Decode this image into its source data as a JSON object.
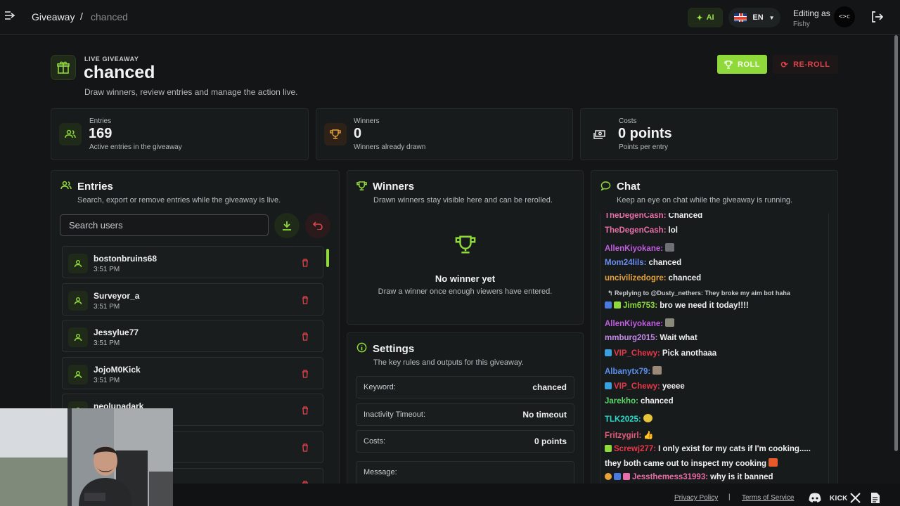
{
  "topbar": {
    "breadcrumb": [
      "Giveaway",
      "/",
      "chanced"
    ],
    "ai_label": "AI",
    "lang": "EN",
    "editing_as": "Editing as",
    "user": "Fishy",
    "avatar_text": "<>c"
  },
  "header": {
    "kicker": "LIVE GIVEAWAY",
    "title": "chanced",
    "subtitle": "Draw winners, review entries and manage the action live.",
    "roll_label": "ROLL",
    "reroll_label": "RE-ROLL"
  },
  "stats": [
    {
      "label": "Entries",
      "value": "169",
      "sub": "Active entries in the giveaway"
    },
    {
      "label": "Winners",
      "value": "0",
      "sub": "Winners already drawn"
    },
    {
      "label": "Costs",
      "value": "0 points",
      "sub": "Points per entry"
    }
  ],
  "entries": {
    "title": "Entries",
    "subtitle": "Search, export or remove entries while the giveaway is live.",
    "search_placeholder": "Search users",
    "items": [
      {
        "name": "bostonbruins68",
        "time": "3:51 PM"
      },
      {
        "name": "Surveyor_a",
        "time": "3:51 PM"
      },
      {
        "name": "Jessylue77",
        "time": "3:51 PM"
      },
      {
        "name": "JojoM0Kick",
        "time": "3:51 PM"
      },
      {
        "name": "neolunadark",
        "time": ""
      },
      {
        "name": "",
        "time": ""
      },
      {
        "name": "",
        "time": ""
      }
    ]
  },
  "winners": {
    "title": "Winners",
    "subtitle": "Drawn winners stay visible here and can be rerolled.",
    "empty_title": "No winner yet",
    "empty_sub": "Draw a winner once enough viewers have entered."
  },
  "settings": {
    "title": "Settings",
    "subtitle": "The key rules and outputs for this giveaway.",
    "rows": [
      {
        "key": "Keyword:",
        "value": "chanced"
      },
      {
        "key": "Inactivity Timeout:",
        "value": "No timeout"
      },
      {
        "key": "Costs:",
        "value": "0 points"
      }
    ],
    "message_label": "Message:"
  },
  "chat": {
    "title": "Chat",
    "subtitle": "Keep an eye on chat while the giveaway is running.",
    "messages": [
      {
        "user": "TheDegenCash:",
        "color": "#e86ea8",
        "text": "Chanced"
      },
      {
        "user": "TheDegenCash:",
        "color": "#e86ea8",
        "text": "lol"
      },
      {
        "user": "AllenKiyokane:",
        "color": "#c15ce0",
        "text": ""
      },
      {
        "user": "Mom24lils:",
        "color": "#6b8cf0",
        "text": "chanced"
      },
      {
        "user": "uncivilizedogre:",
        "color": "#e8a23a",
        "text": "chanced"
      },
      {
        "reply": "Replying to @Dusty_nethers: They broke my aim bot haha"
      },
      {
        "user": "Jim6753:",
        "color": "#8fd93a",
        "text": "bro we need it today!!!!"
      },
      {
        "user": "AllenKiyokane:",
        "color": "#c15ce0",
        "text": ""
      },
      {
        "user": "mmburg2015:",
        "color": "#c48be8",
        "text": "Wait what"
      },
      {
        "user": "VIP_Chewy:",
        "color": "#e8384a",
        "text": "Pick anothaaa"
      },
      {
        "user": "Albanytx79:",
        "color": "#5a8ff0",
        "text": ""
      },
      {
        "user": "VIP_Chewy:",
        "color": "#e8384a",
        "text": "yeeee"
      },
      {
        "user": "Jarekho:",
        "color": "#5ad86a",
        "text": "chanced"
      },
      {
        "user": "TLK2025:",
        "color": "#2ad8c8",
        "text": ""
      },
      {
        "user": "Fritzygirl:",
        "color": "#e85a7a",
        "text": ""
      },
      {
        "user": "Screwj277:",
        "color": "#e8384a",
        "text": "I only exist for my cats if I'm cooking....."
      },
      {
        "text_only": "they both came out to inspect my cooking"
      },
      {
        "user": "Jessthemess31993:",
        "color": "#e86ea8",
        "text": "why is it banned"
      }
    ]
  },
  "footer": {
    "privacy": "Privacy Policy",
    "sep": "|",
    "terms": "Terms of Service",
    "kick_label": "KICK"
  }
}
